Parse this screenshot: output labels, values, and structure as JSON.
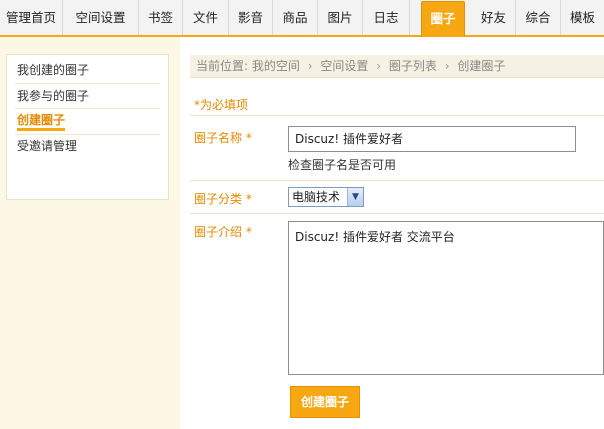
{
  "nav": {
    "tabs": [
      {
        "label": "管理首页"
      },
      {
        "label": "空间设置"
      },
      {
        "label": "书签"
      },
      {
        "label": "文件"
      },
      {
        "label": "影音"
      },
      {
        "label": "商品"
      },
      {
        "label": "图片"
      },
      {
        "label": "日志"
      },
      {
        "label": "圈子"
      },
      {
        "label": "好友"
      },
      {
        "label": "综合"
      },
      {
        "label": "模板"
      }
    ],
    "active_tab": "圈子"
  },
  "sidebar": {
    "items": [
      {
        "label": "我创建的圈子"
      },
      {
        "label": "我参与的圈子"
      },
      {
        "label": "创建圈子"
      },
      {
        "label": "受邀请管理"
      }
    ],
    "active_item": "创建圈子"
  },
  "breadcrumb": {
    "prefix": "当前位置:",
    "items": [
      "我的空间",
      "空间设置",
      "圈子列表",
      "创建圈子"
    ],
    "separator": "›"
  },
  "form": {
    "required_note": "*为必填项",
    "name": {
      "label": "圈子名称 *",
      "value": "Discuz! 插件爱好者",
      "help": "检查圈子名是否可用"
    },
    "category": {
      "label": "圈子分类 *",
      "selected": "电脑技术"
    },
    "intro": {
      "label": "圈子介绍 *",
      "value": "Discuz! 插件爱好者 交流平台"
    },
    "submit_label": "创建圈子"
  },
  "colors": {
    "accent": "#f6a711",
    "accent_text": "#e58a00",
    "sidebar_bg": "#fdf8e6"
  }
}
